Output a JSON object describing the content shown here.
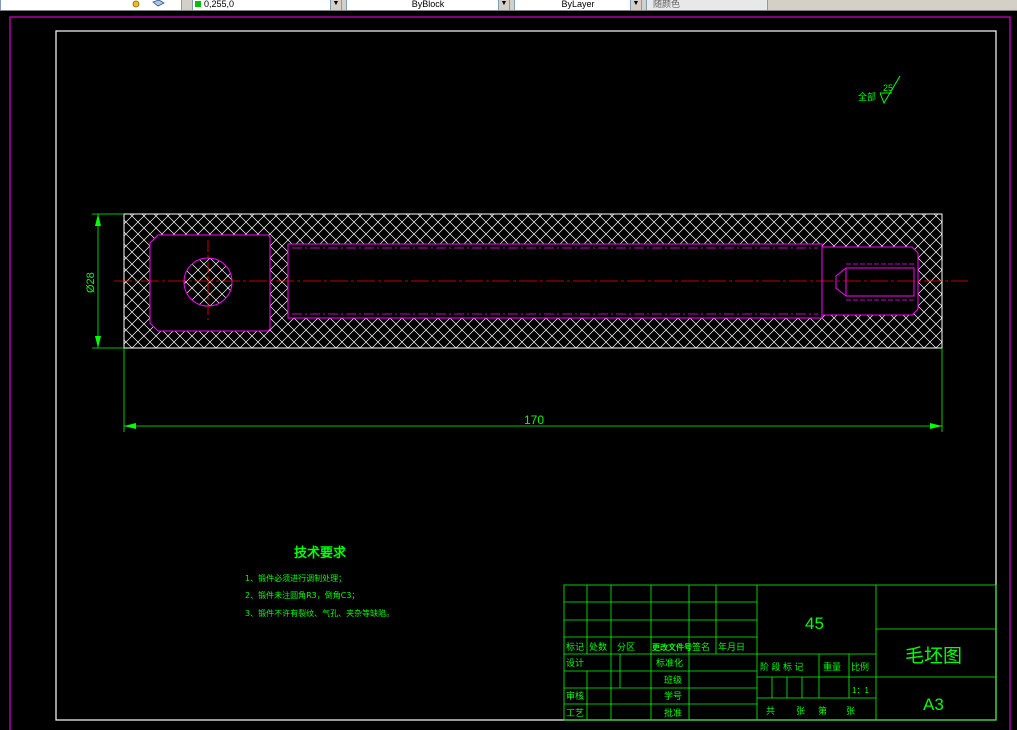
{
  "toolbar": {
    "layer_value": "0,255,0",
    "linetype_value": "ByBlock",
    "lineweight_value": "ByLayer",
    "plotstyle_value": "随颜色",
    "colors": {
      "bg": "#d4d0c8",
      "layer_swatch": "#00c000"
    }
  },
  "drawing": {
    "background": "#000000",
    "colors": {
      "outline": "#ffffff",
      "dimension": "#00ff00",
      "part": "#ff00ff",
      "center": "#ff0000",
      "hatch": "#ffffff",
      "text": "#00ff00"
    },
    "roughness": {
      "prefix": "全部",
      "value": "25"
    },
    "dim_diameter": "Ø28",
    "dim_length": "170",
    "tech_req": {
      "title": "技术要求",
      "items": [
        "1、锻件必须进行调制处理；",
        "2、锻件未注圆角R3，倒角C3；",
        "3、锻件不许有裂纹、气孔、夹杂等缺陷。"
      ]
    },
    "title_block": {
      "material": "45",
      "name": "毛坯图",
      "sheet_size": "A3",
      "scale": "1：1",
      "labels": {
        "mark": "标记",
        "count": "处数",
        "zone": "分区",
        "change_doc": "更改文件号",
        "signature": "签名",
        "date": "年月日",
        "design": "设计",
        "standardize": "标准化",
        "class": "班级",
        "review": "审核",
        "student_no": "学号",
        "process": "工艺",
        "approve": "批准",
        "stage_mark": "阶 段 标 记",
        "weight": "重量",
        "scale": "比例",
        "total": "共",
        "sheet": "张",
        "page_no": "第",
        "sheet2": "张"
      }
    }
  }
}
